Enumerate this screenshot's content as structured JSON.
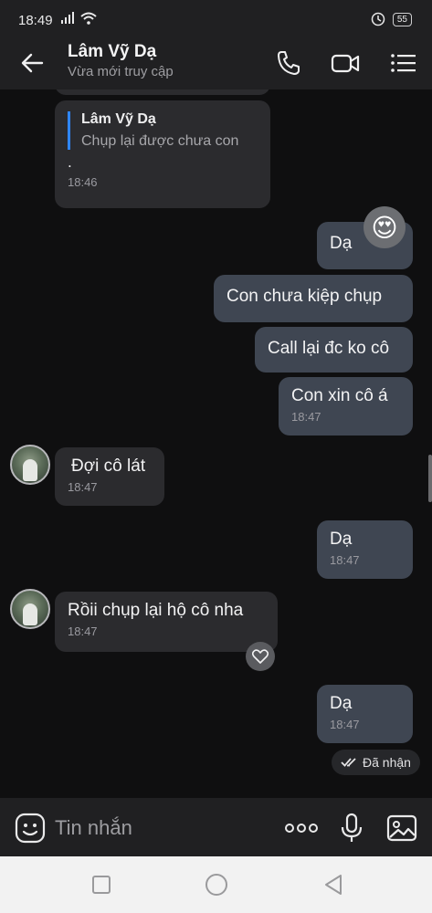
{
  "status_bar": {
    "time": "18:49",
    "battery": "55"
  },
  "header": {
    "contact_name": "Lâm Vỹ Dạ",
    "contact_status": "Vừa mới truy cập"
  },
  "messages": [
    {
      "quote_author": "Lâm Vỹ Dạ",
      "quote_text": "Chụp lại được chưa con",
      "text": ".",
      "time": "18:46"
    },
    {
      "text": "Dạ",
      "reaction": "😍"
    },
    {
      "text": "Con chưa kiệp chụp"
    },
    {
      "text": "Call lại đc ko cô"
    },
    {
      "text": "Con xin cô á",
      "time": "18:47"
    },
    {
      "text": "Đợi cô lát",
      "time": "18:47"
    },
    {
      "text": "Dạ",
      "time": "18:47"
    },
    {
      "text": "Rồii chụp lại hộ cô nha",
      "time": "18:47"
    },
    {
      "text": "Dạ",
      "time": "18:47"
    }
  ],
  "delivery_status": "Đã nhận",
  "composer": {
    "placeholder": "Tin nhắn"
  },
  "colors": {
    "accent": "#2f86ff",
    "outgoing_bubble": "#3f4652",
    "incoming_bubble": "#2b2b2e"
  },
  "icons": [
    "back-arrow-icon",
    "phone-icon",
    "video-camera-icon",
    "menu-list-icon",
    "sticker-icon",
    "more-dots-icon",
    "microphone-icon",
    "image-icon",
    "heart-icon",
    "double-check-icon"
  ]
}
